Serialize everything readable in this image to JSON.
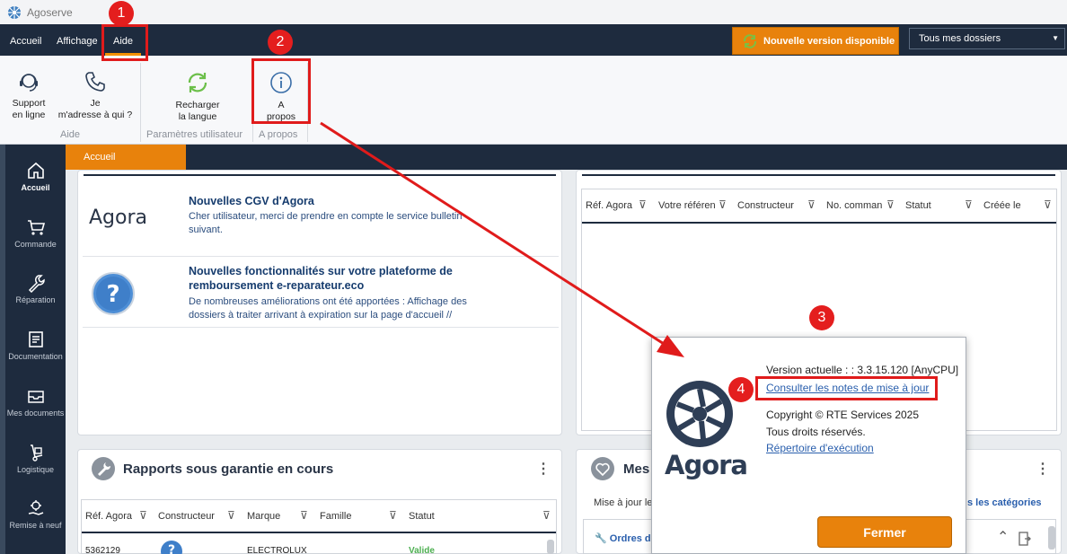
{
  "app": {
    "title": "Agoserve"
  },
  "menu": {
    "items": [
      "Accueil",
      "Affichage",
      "Aide"
    ],
    "update_button": "Nouvelle version disponible",
    "folder_select": "Tous mes dossiers"
  },
  "ribbon": {
    "support_label": "Support\nen ligne",
    "contact_label": "Je\nm'adresse à qui ?",
    "group_aide": "Aide",
    "reload_label": "Recharger\nla langue",
    "group_params": "Paramètres utilisateur",
    "about_label": "A\npropos",
    "group_about": "A propos"
  },
  "sidebar": {
    "items": [
      "Accueil",
      "Commande",
      "Réparation",
      "Documentation",
      "Mes documents",
      "Logistique",
      "Remise à neuf"
    ]
  },
  "tabs": {
    "home": "Accueil"
  },
  "news": [
    {
      "logo_text": "Agora",
      "title": "Nouvelles CGV d'Agora",
      "body": "Cher utilisateur, merci de prendre en compte le service bulletin suivant."
    },
    {
      "title": "Nouvelles fonctionnalités sur votre plateforme de remboursement e-reparateur.eco",
      "body": "De nombreuses améliorations ont été apportées :  Affichage des dossiers à traiter arrivant à expiration sur la page d'accueil //"
    }
  ],
  "orders_grid": {
    "headers": [
      "Réf. Agora",
      "Votre référen",
      "Constructeur",
      "No. comman",
      "Statut",
      "Créée le"
    ]
  },
  "reports": {
    "title": "Rapports sous garantie en cours",
    "headers": [
      "Réf. Agora",
      "Constructeur",
      "Marque",
      "Famille",
      "Statut"
    ],
    "row": {
      "ref": "5362129",
      "brand": "ELECTROLUX",
      "status": "Valide"
    }
  },
  "messages": {
    "title": "Mes",
    "subtitle": "Mise à jour le",
    "categories_link": "s les catégories",
    "order_link": "Ordres de"
  },
  "dialog": {
    "version": "Version actuelle :  : 3.3.15.120 [AnyCPU]",
    "notes_link": "Consulter les notes de mise à jour",
    "copyright": "Copyright © RTE Services 2025",
    "rights": "Tous droits réservés.",
    "exec_link": "Répertoire d'exécution",
    "brand": "Agora",
    "close_button": "Fermer"
  },
  "annotations": [
    "1",
    "2",
    "3",
    "4"
  ],
  "colors": {
    "navy": "#1e2b3e",
    "orange": "#e8820c",
    "red": "#e01b1b",
    "link": "#2a5fad"
  }
}
